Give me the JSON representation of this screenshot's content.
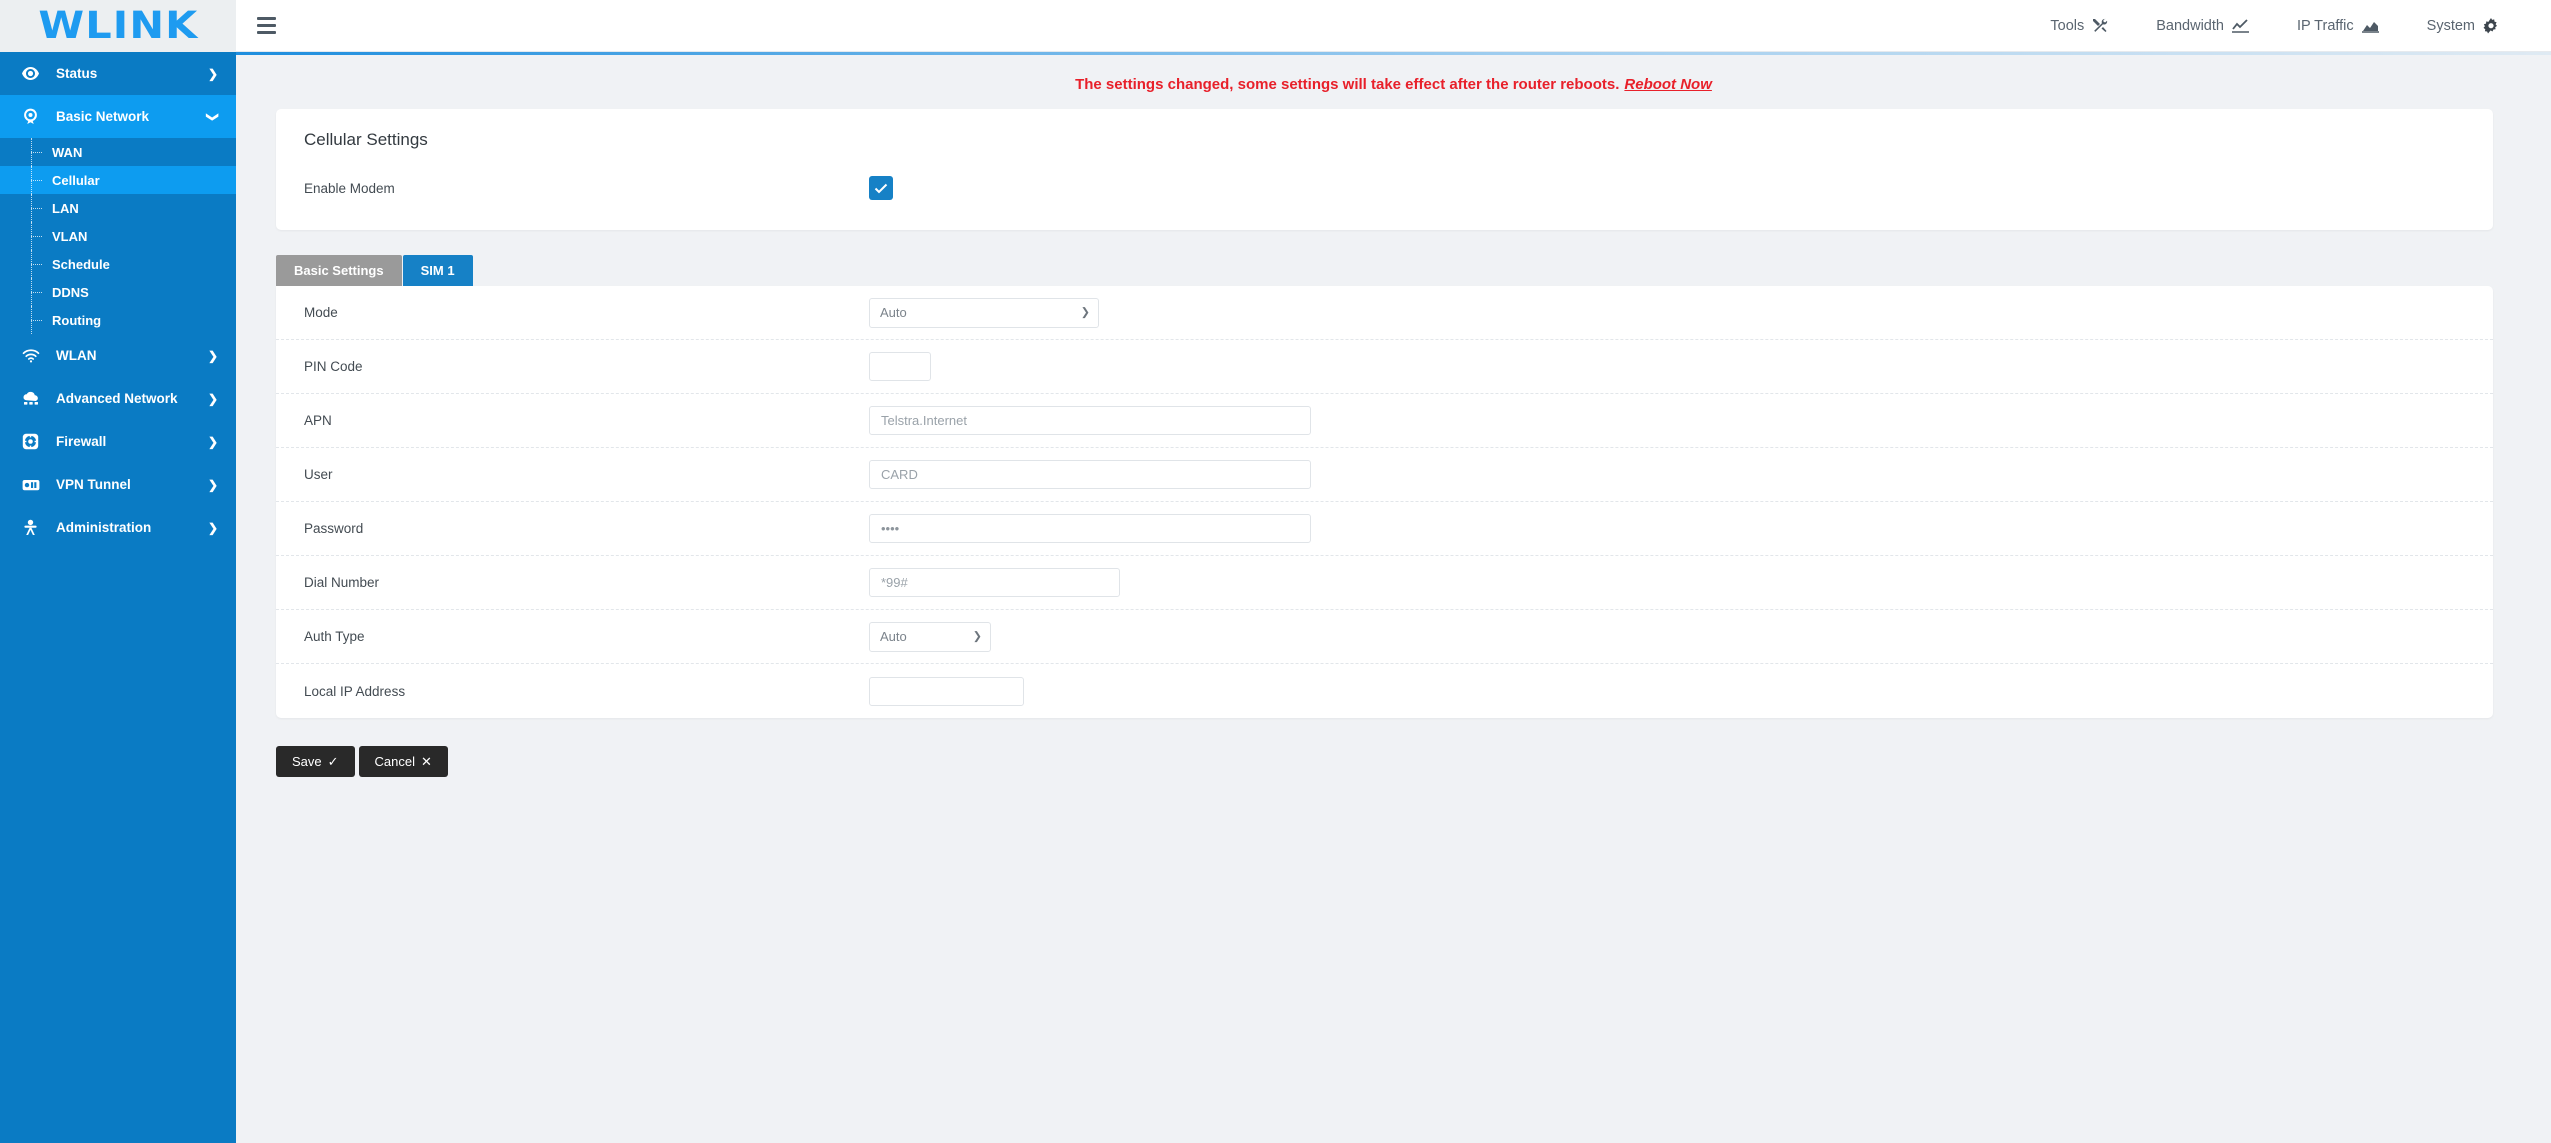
{
  "header": {
    "brand": "WLINK",
    "menu_toggle_label": "Menu",
    "nav": [
      {
        "label": "Tools",
        "icon": "tools-icon"
      },
      {
        "label": "Bandwidth",
        "icon": "chart-line-icon"
      },
      {
        "label": "IP Traffic",
        "icon": "chart-area-icon"
      },
      {
        "label": "System",
        "icon": "gear-icon"
      }
    ]
  },
  "sidebar": {
    "items": [
      {
        "label": "Status",
        "icon": "eye-icon",
        "caret": "right",
        "state": "closed"
      },
      {
        "label": "Basic Network",
        "icon": "globe-icon",
        "caret": "down",
        "state": "open"
      },
      {
        "label": "WLAN",
        "icon": "wifi-icon",
        "caret": "right",
        "state": "closed"
      },
      {
        "label": "Advanced Network",
        "icon": "cloud-net-icon",
        "caret": "right",
        "state": "closed"
      },
      {
        "label": "Firewall",
        "icon": "shield-icon",
        "caret": "right",
        "state": "closed"
      },
      {
        "label": "VPN Tunnel",
        "icon": "tunnel-icon",
        "caret": "right",
        "state": "closed"
      },
      {
        "label": "Administration",
        "icon": "admin-icon",
        "caret": "right",
        "state": "closed"
      }
    ],
    "basic_network_submenu": [
      {
        "label": "WAN",
        "active": false
      },
      {
        "label": "Cellular",
        "active": true
      },
      {
        "label": "LAN",
        "active": false
      },
      {
        "label": "VLAN",
        "active": false
      },
      {
        "label": "Schedule",
        "active": false
      },
      {
        "label": "DDNS",
        "active": false
      },
      {
        "label": "Routing",
        "active": false
      }
    ],
    "colors": {
      "base": "#0a7bc4",
      "highlight": "#0d9cf0"
    }
  },
  "banner": {
    "message": "The settings changed, some settings will take effect after the router reboots.",
    "link_label": "Reboot Now",
    "color": "#e8202a"
  },
  "card": {
    "title": "Cellular Settings",
    "enable_modem_label": "Enable Modem",
    "enable_modem_checked": true,
    "checkbox_color": "#1681c6"
  },
  "tabs": [
    {
      "label": "Basic Settings",
      "active": false
    },
    {
      "label": "SIM 1",
      "active": true
    }
  ],
  "form": {
    "rows": [
      {
        "label": "Mode",
        "type": "select",
        "value": "Auto",
        "placeholder": ""
      },
      {
        "label": "PIN Code",
        "type": "text",
        "value": "",
        "placeholder": ""
      },
      {
        "label": "APN",
        "type": "text",
        "value": "",
        "placeholder": "Telstra.Internet"
      },
      {
        "label": "User",
        "type": "text",
        "value": "",
        "placeholder": "CARD"
      },
      {
        "label": "Password",
        "type": "password",
        "value": "1234",
        "placeholder": ""
      },
      {
        "label": "Dial Number",
        "type": "text",
        "value": "",
        "placeholder": "*99#"
      },
      {
        "label": "Auth Type",
        "type": "select",
        "value": "Auto",
        "placeholder": ""
      },
      {
        "label": "Local IP Address",
        "type": "text",
        "value": "",
        "placeholder": ""
      }
    ],
    "mode_options": [
      "Auto"
    ],
    "auth_options": [
      "Auto"
    ]
  },
  "actions": {
    "save_label": "Save",
    "save_glyph": "✓",
    "cancel_label": "Cancel",
    "cancel_glyph": "✕"
  }
}
